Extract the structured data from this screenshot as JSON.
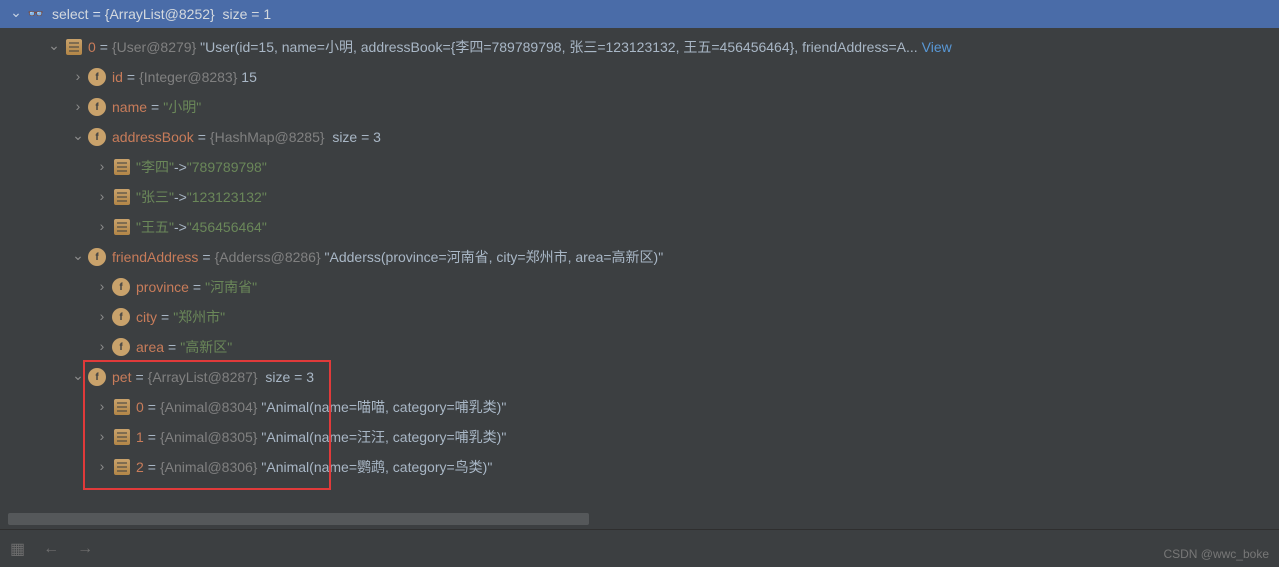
{
  "header": {
    "var": "select",
    "type": "{ArrayList@8252}",
    "size_label": "size = 1"
  },
  "root": {
    "index": "0",
    "type": "{User@8279}",
    "tostring": "\"User(id=15, name=小明, addressBook={李四=789789798, 张三=123123132, 王五=456456464}, friendAddress=A...",
    "view": "View"
  },
  "fields": {
    "id": {
      "name": "id",
      "type": "{Integer@8283}",
      "value": "15"
    },
    "name": {
      "name": "name",
      "value": "\"小明\""
    },
    "addressBook": {
      "name": "addressBook",
      "type": "{HashMap@8285}",
      "size": "size = 3"
    },
    "friendAddress": {
      "name": "friendAddress",
      "type": "{Adderss@8286}",
      "tostring": "\"Adderss(province=河南省, city=郑州市, area=高新区)\""
    },
    "pet": {
      "name": "pet",
      "type": "{ArrayList@8287}",
      "size": "size = 3"
    }
  },
  "addressEntries": [
    {
      "key": "\"李四\"",
      "val": "\"789789798\""
    },
    {
      "key": "\"张三\"",
      "val": "\"123123132\""
    },
    {
      "key": "\"王五\"",
      "val": "\"456456464\""
    }
  ],
  "friendFields": {
    "province": {
      "name": "province",
      "value": "\"河南省\""
    },
    "city": {
      "name": "city",
      "value": "\"郑州市\""
    },
    "area": {
      "name": "area",
      "value": "\"高新区\""
    }
  },
  "pets": [
    {
      "index": "0",
      "type": "{Animal@8304}",
      "tostring": "\"Animal(name=喵喵, category=哺乳类)\""
    },
    {
      "index": "1",
      "type": "{Animal@8305}",
      "tostring": "\"Animal(name=汪汪, category=哺乳类)\""
    },
    {
      "index": "2",
      "type": "{Animal@8306}",
      "tostring": "\"Animal(name=鹦鹉, category=鸟类)\""
    }
  ],
  "footer": {
    "watermark": "CSDN @wwc_boke"
  }
}
